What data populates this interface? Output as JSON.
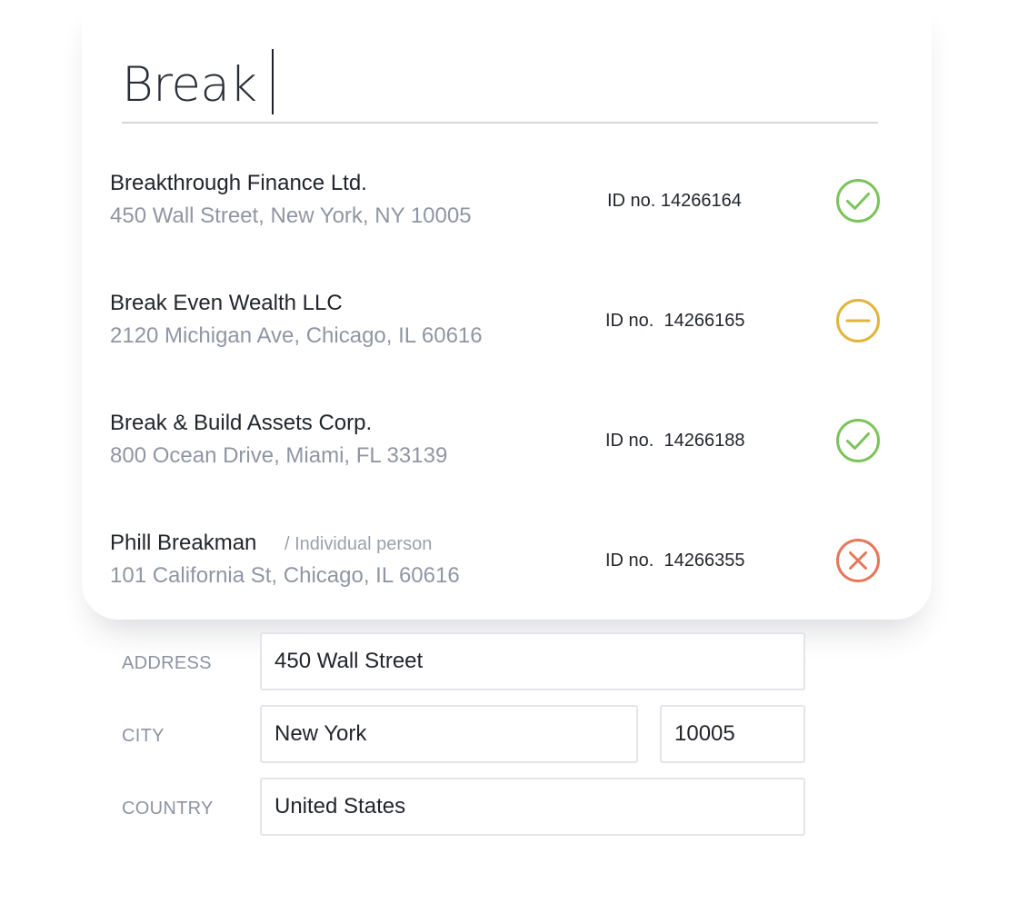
{
  "search": {
    "value": "Break"
  },
  "results": [
    {
      "name": "Breakthrough Finance Ltd.",
      "tag": "",
      "address": "450 Wall Street, New York, NY 10005",
      "id": "ID no. 14266164",
      "status": "approved",
      "status_icon": "check-circle-icon",
      "status_color": "#7cc35a"
    },
    {
      "name": "Break Even Wealth LLC",
      "tag": "",
      "address": "2120 Michigan Ave, Chicago, IL 60616",
      "id": "ID no.  14266165",
      "status": "pending",
      "status_icon": "minus-circle-icon",
      "status_color": "#e2b43a"
    },
    {
      "name": "Break & Build Assets Corp.",
      "tag": "",
      "address": "800 Ocean Drive, Miami, FL 33139",
      "id": "ID no.  14266188",
      "status": "approved",
      "status_icon": "check-circle-icon",
      "status_color": "#7cc35a"
    },
    {
      "name": "Phill Breakman",
      "tag": "/ Individual person",
      "address": "101 California St, Chicago, IL 60616",
      "id": "ID no.  14266355",
      "status": "rejected",
      "status_icon": "x-circle-icon",
      "status_color": "#e7765a"
    }
  ],
  "form": {
    "address_label": "ADDRESS",
    "address_value": "450 Wall Street",
    "city_label": "CITY",
    "city_value": "New York",
    "zip_value": "10005",
    "country_label": "COUNTRY",
    "country_value": "United States"
  }
}
